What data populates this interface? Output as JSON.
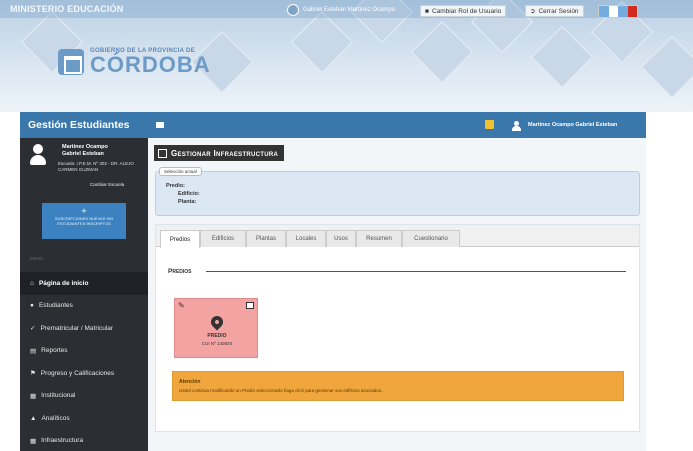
{
  "header": {
    "ministry": "MINISTERIO EDUCACIÓN",
    "user_text": "Gabriel Esteban Martinez Ocampo",
    "change_role": "Cambiar Rol de Usuario",
    "logout": "Cerrar Sesión",
    "logo_subtitle": "GOBIERNO DE LA PROVINCIA DE",
    "logo_title": "CÓRDOBA"
  },
  "sidebar": {
    "title": "Gestión Estudiantes",
    "profile_name": "Martinez Ocampo Gabriel Esteban",
    "profile_school": "Escuela: I.P.E.M. Nº 302 - DR. ALEJO CARMEN GUZMAN",
    "change_school": "Cambiar Escuela",
    "add_box_text": "SUSCRIPCIONES NUEVAS SIN ESTUDIANTES INSCRIPTOS",
    "menu_section": "MENÚ",
    "menu": [
      {
        "label": "Página de inicio",
        "icon": "home-icon",
        "active": true
      },
      {
        "label": "Estudiantes",
        "icon": "person-icon",
        "active": false
      },
      {
        "label": "Prematricular / Matricular",
        "icon": "check-icon",
        "active": false
      },
      {
        "label": "Reportes",
        "icon": "report-icon",
        "active": false
      },
      {
        "label": "Progreso y Calificaciones",
        "icon": "flag-icon",
        "active": false
      },
      {
        "label": "Institucional",
        "icon": "building-icon",
        "active": false
      },
      {
        "label": "Analíticos",
        "icon": "graduation-icon",
        "active": false
      },
      {
        "label": "Infraestructura",
        "icon": "building-icon",
        "active": false
      }
    ]
  },
  "topbar": {
    "user_name": "Martinez Ocampo Gabriel Esteban"
  },
  "main": {
    "page_title": "Gestionar Infraestructura",
    "selection_legend": "Selección actual",
    "selection_lines": [
      "Predio:",
      "Edificio:",
      "Planta:"
    ],
    "tabs": [
      "Predios",
      "Edificios",
      "Plantas",
      "Locales",
      "Usos",
      "Resumen",
      "Cuestionario"
    ],
    "active_tab": "Predios",
    "section_title": "Predios",
    "card": {
      "title": "PREDIO",
      "subtitle": "CUI Nº 140920"
    },
    "alert": {
      "title": "Atención",
      "body": "Usted continua modificando un Predio seleccionado haga click para gestionar sus edificios asociados..."
    }
  },
  "colors": {
    "primary": "#3a77ab",
    "sidebar": "#2b2f33",
    "card": "#f4a3a3",
    "alert": "#f0a63d"
  }
}
